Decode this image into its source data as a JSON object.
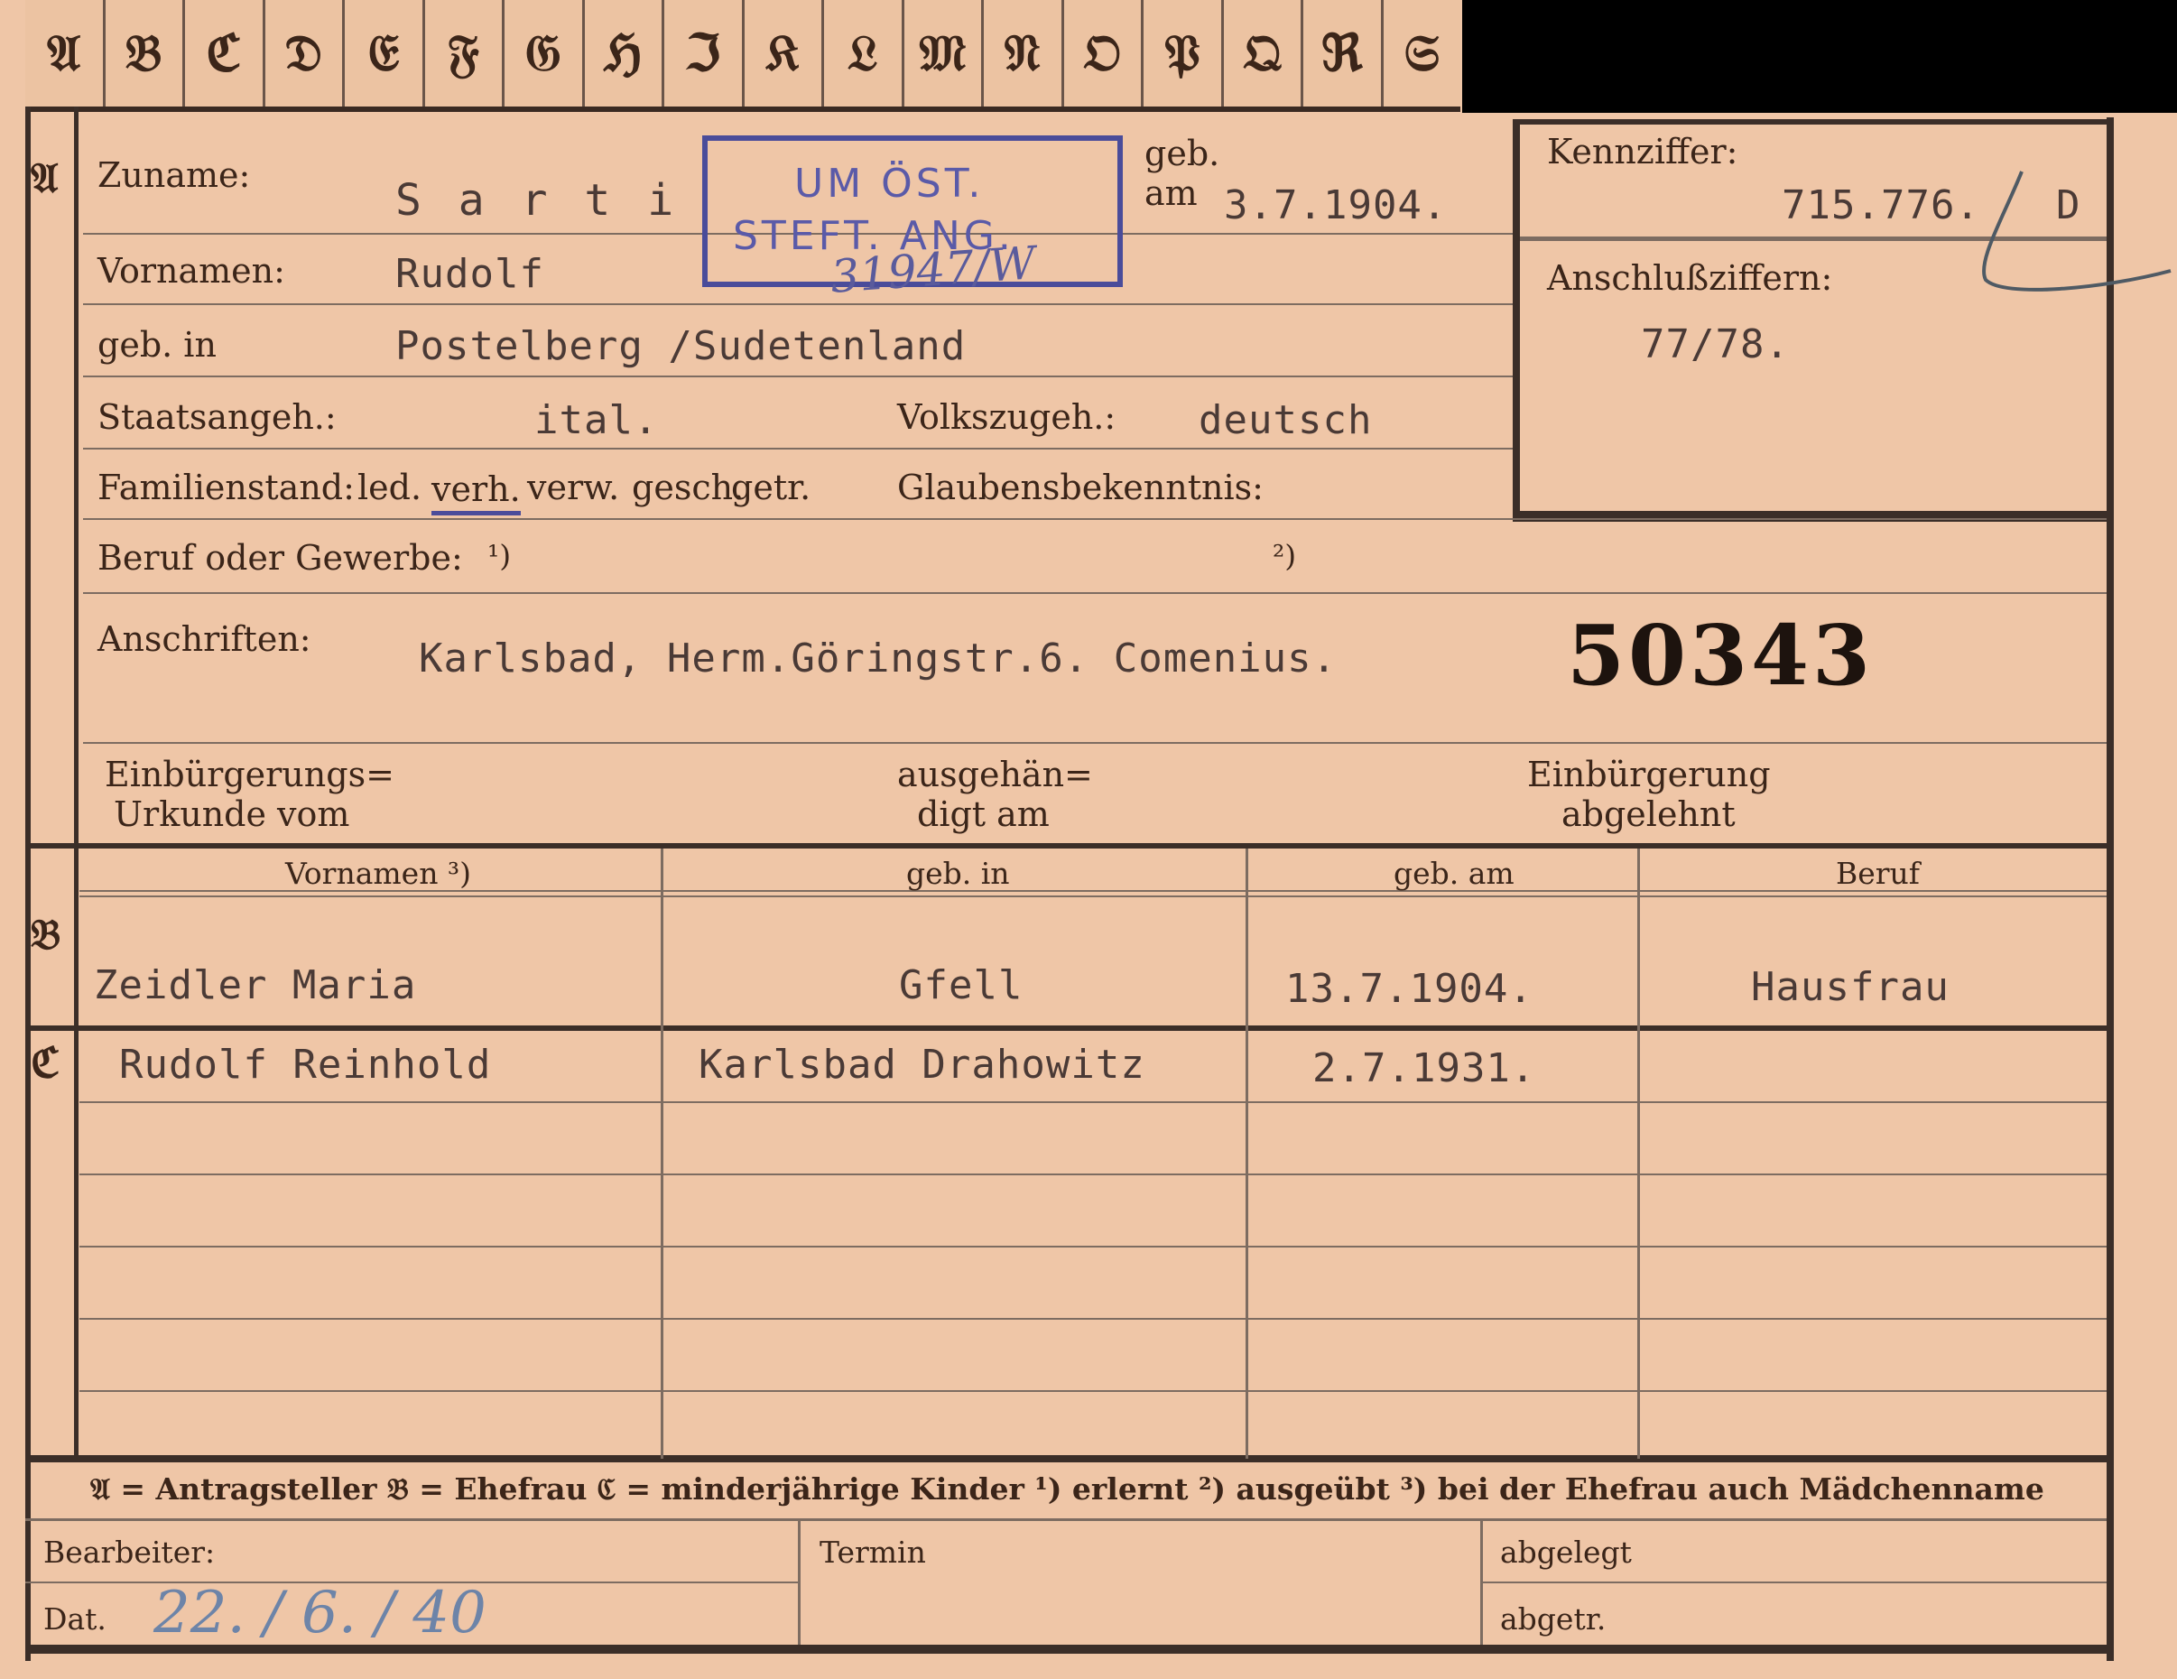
{
  "tabs": [
    "𝔄",
    "𝔅",
    "ℭ",
    "𝔇",
    "𝔈",
    "𝔉",
    "𝔊",
    "ℌ",
    "ℑ",
    "𝔎",
    "𝔏",
    "𝔐",
    "𝔑",
    "𝔒",
    "𝔓",
    "𝔔",
    "ℜ",
    "𝔖"
  ],
  "side_letters": {
    "a": "𝔄",
    "b": "𝔅",
    "c": "ℭ"
  },
  "section_a": {
    "zuname_label": "Zuname:",
    "zuname_value": "S a r t i",
    "vornamen_label": "Vornamen:",
    "vornamen_value": "Rudolf",
    "geb_in_label": "geb. in",
    "geb_in_value": "Postelberg /Sudetenland",
    "staatsangeh_label": "Staatsangeh.:",
    "staatsangeh_value": "ital.",
    "volkszugeh_label": "Volkszugeh.:",
    "volkszugeh_value": "deutsch",
    "familienstand_label": "Familienstand:",
    "familienstand_options": [
      "led.",
      "verh.",
      "verw.",
      "gesch.",
      "getr."
    ],
    "glaubens_label": "Glaubensbekenntnis:",
    "beruf_label": "Beruf oder Gewerbe:",
    "beruf_note1": "¹)",
    "beruf_note2": "²)",
    "anschriften_label": "Anschriften:",
    "anschriften_value": "Karlsbad, Herm.Göringstr.6. Comenius.",
    "big_number": "50343",
    "geb_am_label_1": "geb.",
    "geb_am_label_2": "am",
    "geb_am_value": "3.7.1904.",
    "einb_urkunde_1": "Einbürgerungs=",
    "einb_urkunde_2": "Urkunde vom",
    "ausgehaendigt_1": "ausgehän=",
    "ausgehaendigt_2": "digt am",
    "einb_abgelehnt_1": "Einbürgerung",
    "einb_abgelehnt_2": "abgelehnt"
  },
  "stamp": {
    "line1": "UM ÖST.",
    "line2": "STEFT. ANG.",
    "handwritten": "31947/W"
  },
  "kennziffer": {
    "label": "Kennziffer:",
    "value": "715.776.",
    "suffix": "D",
    "anschluss_label": "Anschlußziffern:",
    "anschluss_value": "77/78."
  },
  "table": {
    "headers": [
      "Vornamen ³)",
      "geb. in",
      "geb. am",
      "Beruf"
    ],
    "ehefrau": {
      "name": "Zeidler Maria",
      "geb_in": "Gfell",
      "geb_am": "13.7.1904.",
      "beruf": "Hausfrau"
    },
    "kinder": [
      {
        "name": "Rudolf Reinhold",
        "geb_in": "Karlsbad Drahowitz",
        "geb_am": "2.7.1931.",
        "beruf": ""
      }
    ]
  },
  "legend": "𝔄 = Antragsteller   𝔅 = Ehefrau   ℭ = minderjährige Kinder   ¹) erlernt   ²) ausgeübt   ³) bei der Ehefrau auch Mädchenname",
  "footer": {
    "bearbeiter_label": "Bearbeiter:",
    "dat_label": "Dat.",
    "dat_value": "22. / 6. / 40",
    "termin_label": "Termin",
    "abgelegt_label": "abgelegt",
    "abgetr_label": "abgetr."
  }
}
